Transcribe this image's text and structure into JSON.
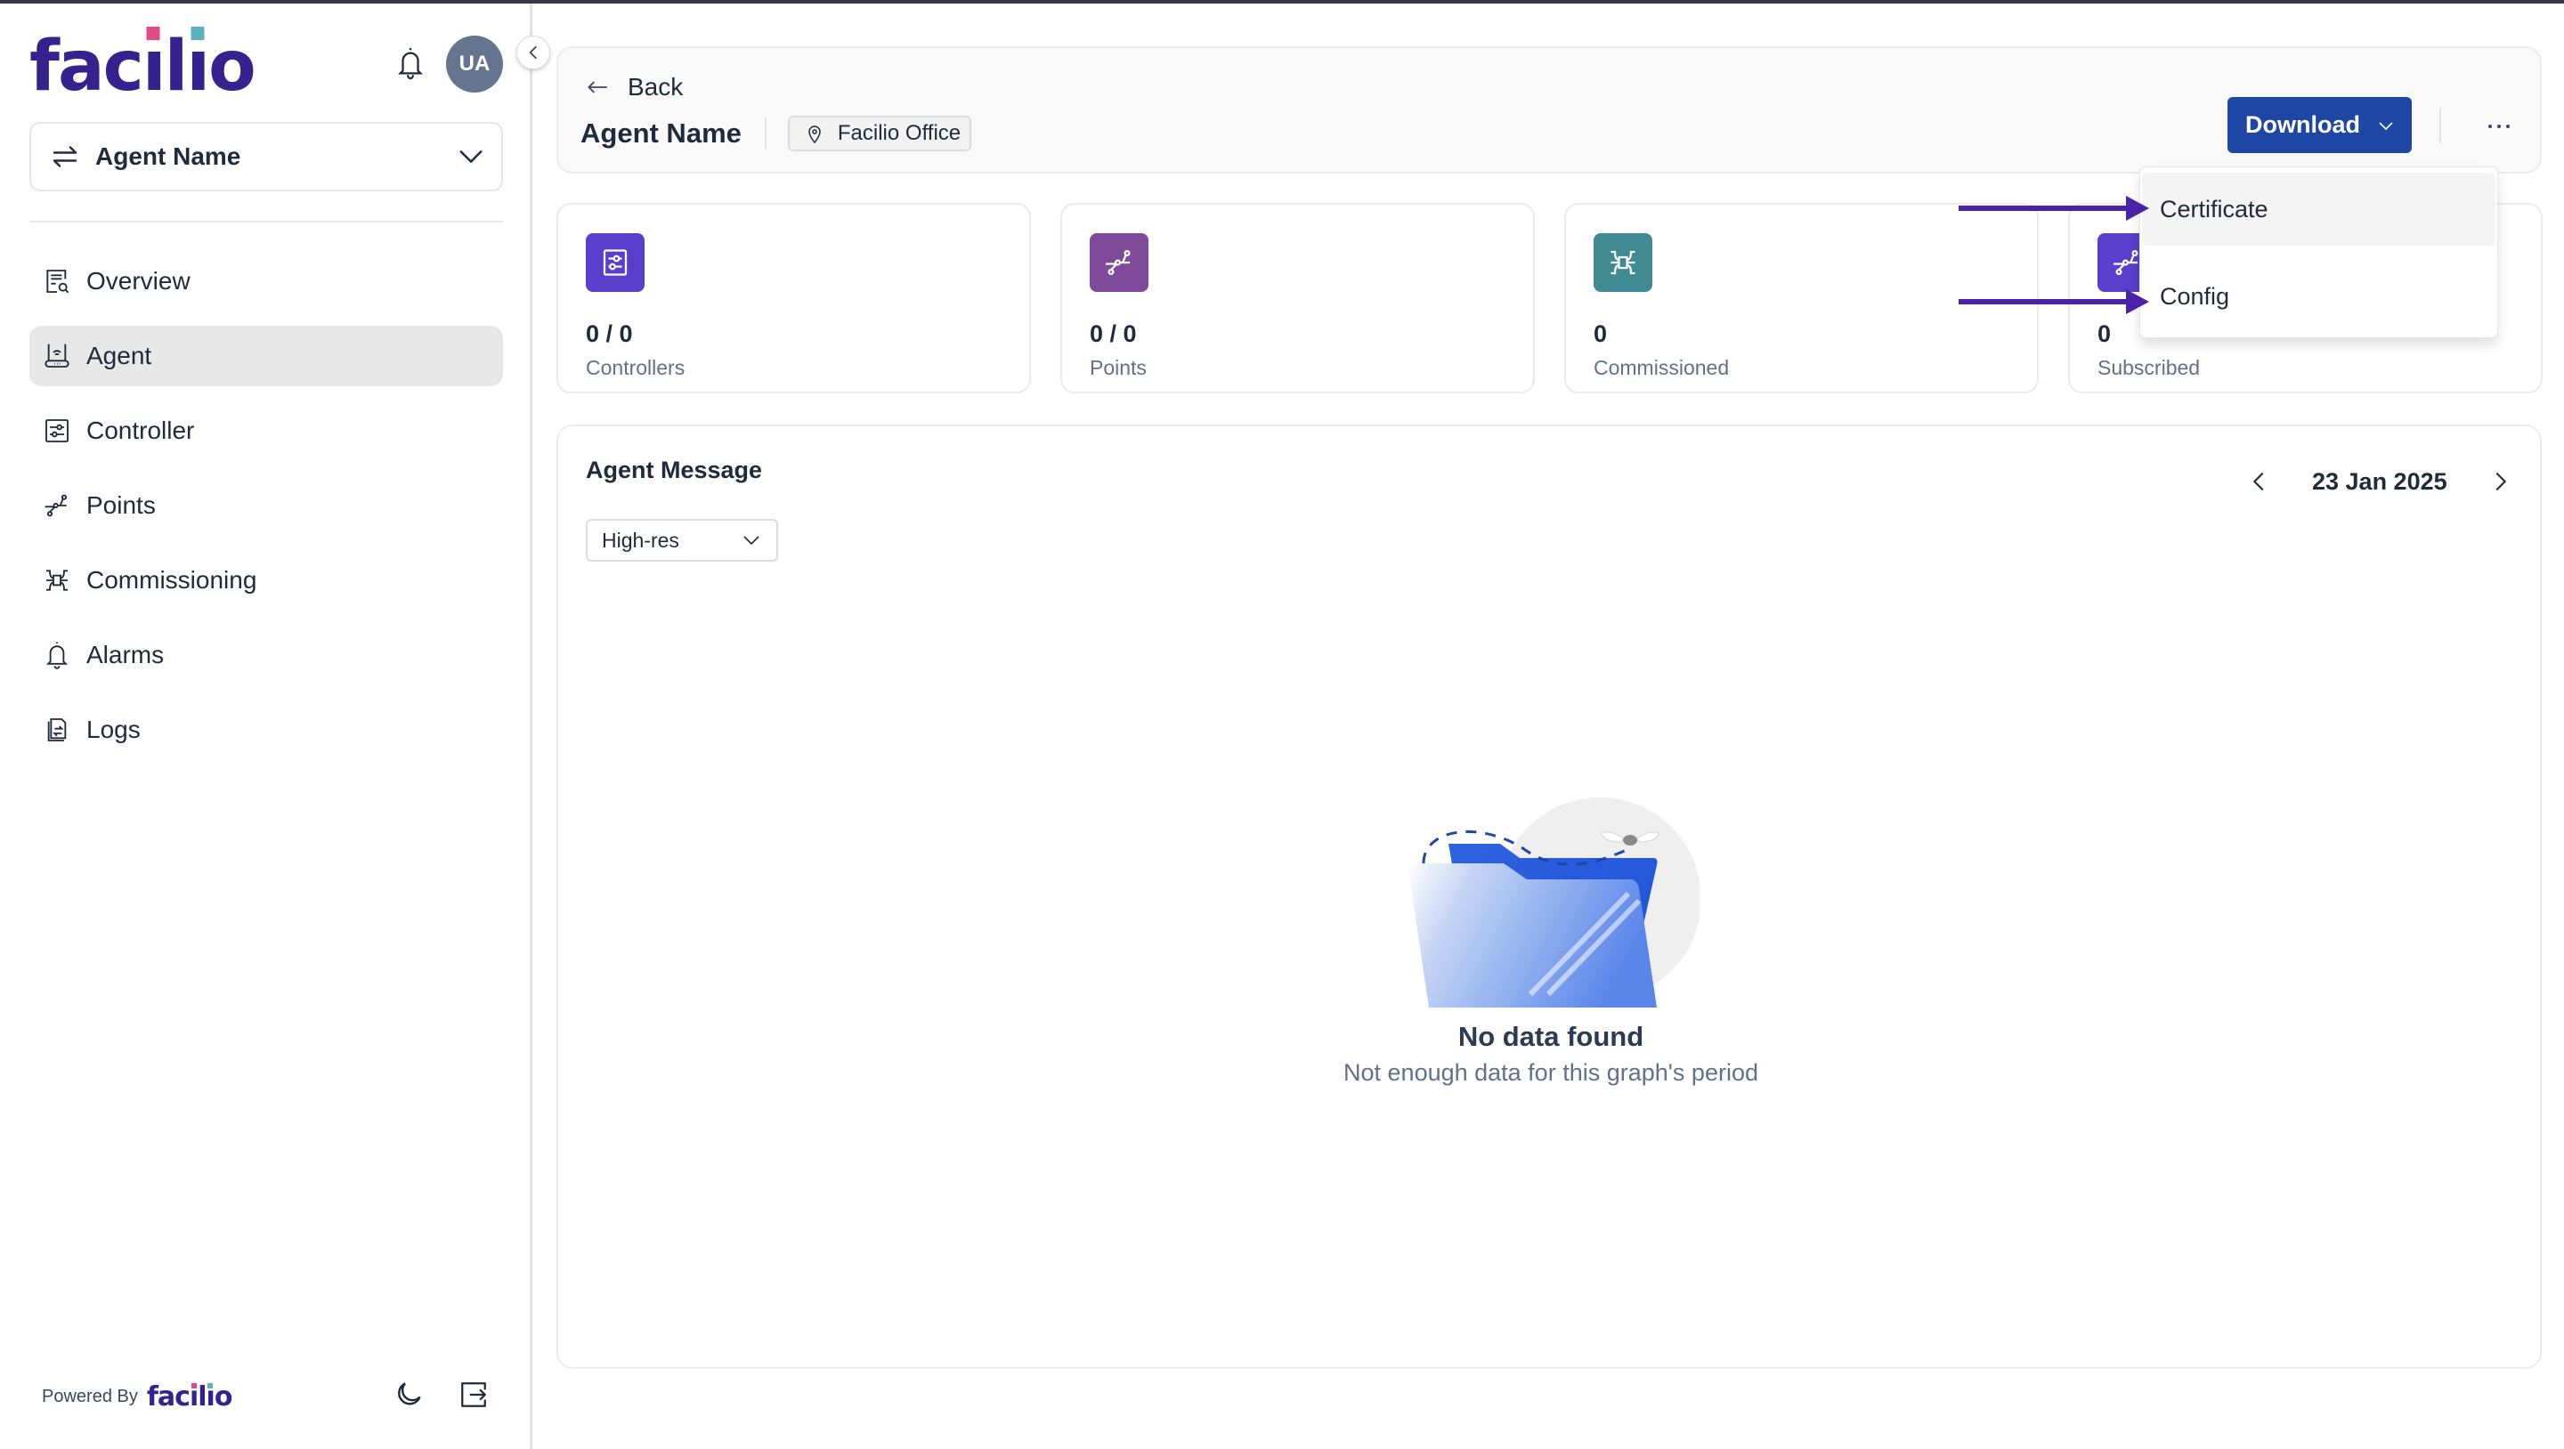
{
  "brand": {
    "logo_text": "facilio",
    "primary_color": "#35228f",
    "dot_colors": [
      "#e04a86",
      "#5ab2c0"
    ]
  },
  "sidebar": {
    "user_initials": "UA",
    "agent_selector": {
      "label": "Agent Name",
      "icon": "swap-arrows-icon"
    },
    "nav_items": [
      {
        "label": "Overview",
        "icon": "overview-icon",
        "active": false
      },
      {
        "label": "Agent",
        "icon": "router-icon",
        "active": true
      },
      {
        "label": "Controller",
        "icon": "controller-icon",
        "active": false
      },
      {
        "label": "Points",
        "icon": "points-icon",
        "active": false
      },
      {
        "label": "Commissioning",
        "icon": "commissioning-icon",
        "active": false
      },
      {
        "label": "Alarms",
        "icon": "bell-icon",
        "active": false
      },
      {
        "label": "Logs",
        "icon": "logs-icon",
        "active": false
      }
    ],
    "footer": {
      "powered_by": "Powered By",
      "logo_text": "facilio"
    }
  },
  "header": {
    "back_label": "Back",
    "title": "Agent Name",
    "site_chip": "Facilio Office",
    "download_label": "Download",
    "download_color": "#1e46a4"
  },
  "download_menu": {
    "items": [
      {
        "label": "Certificate",
        "hovered": true
      },
      {
        "label": "Config",
        "hovered": false
      }
    ],
    "annotation_arrow_color": "#4a22a8"
  },
  "stats": [
    {
      "value": "0 / 0",
      "label": "Controllers",
      "icon": "controller-icon",
      "color": "#5a3fcc"
    },
    {
      "value": "0 / 0",
      "label": "Points",
      "icon": "points-icon",
      "color": "#7e4a99"
    },
    {
      "value": "0",
      "label": "Commissioned",
      "icon": "commissioning-icon",
      "color": "#418a93"
    },
    {
      "value": "0",
      "label": "Subscribed",
      "icon": "points-icon",
      "color": "#5a3fcc"
    }
  ],
  "agent_message": {
    "title": "Agent Message",
    "resolution": "High-res",
    "date": "23 Jan 2025",
    "empty_title": "No data found",
    "empty_subtitle": "Not enough data for this graph's period"
  }
}
